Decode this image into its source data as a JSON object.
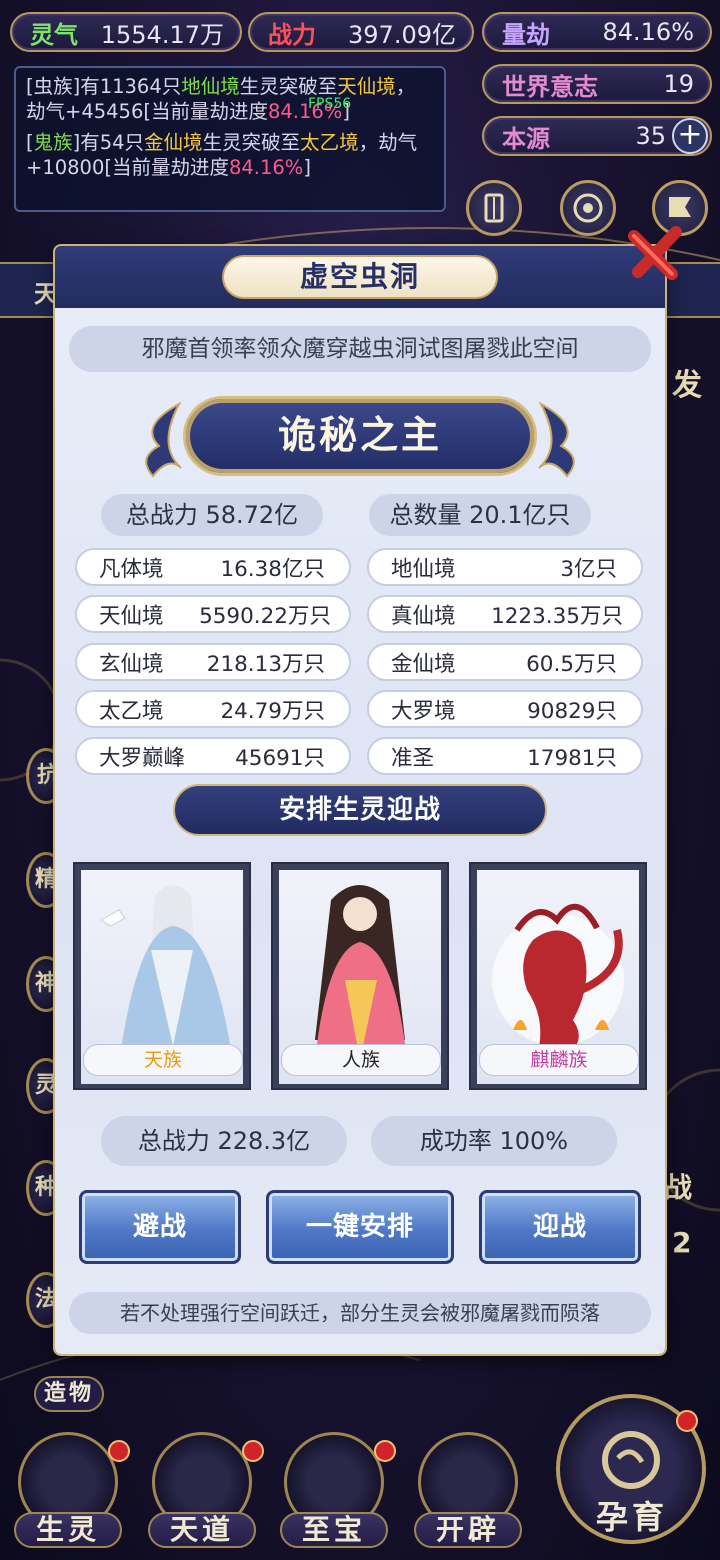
{
  "resources": {
    "lingqi": {
      "label": "灵气",
      "value": "1554.17万"
    },
    "zhanli": {
      "label": "战力",
      "value": "397.09亿"
    },
    "liangjie": {
      "label": "量劫",
      "value": "84.16%"
    },
    "shijie": {
      "label": "世界意志",
      "value": "19"
    },
    "benyuan": {
      "label": "本源",
      "value": "35"
    }
  },
  "fps": "FPS56",
  "log": [
    {
      "a": "[虫族]有11364只",
      "b": "地仙境",
      "c": "生灵突破至",
      "d": "天仙境",
      "e": "，劫气+45456[当前量劫进度",
      "f": "84.16%",
      "g": "]"
    },
    {
      "a": "[",
      "a2": "鬼族",
      "a3": "]有54只",
      "b": "金仙境",
      "c": "生灵突破至",
      "d": "太乙境",
      "e": "，劫气+10800[当前量劫进度",
      "f": "84.16%",
      "g": "]"
    }
  ],
  "side_left": {
    "t1": "天"
  },
  "side_right": {
    "t1": "发",
    "t2": "战",
    "t3": "2"
  },
  "left_buttons": [
    "抗",
    "精",
    "神",
    "灵",
    "种",
    "法"
  ],
  "zaowu": "造物",
  "modal": {
    "title": "虚空虫洞",
    "banner": "邪魔首领率领众魔穿越虫洞试图屠戮此空间",
    "boss": "诡秘之主",
    "total_power": "总战力 58.72亿",
    "total_count": "总数量 20.1亿只",
    "realms": [
      {
        "name": "凡体境",
        "count": "16.38亿只"
      },
      {
        "name": "地仙境",
        "count": "3亿只"
      },
      {
        "name": "天仙境",
        "count": "5590.22万只"
      },
      {
        "name": "真仙境",
        "count": "1223.35万只"
      },
      {
        "name": "玄仙境",
        "count": "218.13万只"
      },
      {
        "name": "金仙境",
        "count": "60.5万只"
      },
      {
        "name": "太乙境",
        "count": "24.79万只"
      },
      {
        "name": "大罗境",
        "count": "90829只"
      },
      {
        "name": "大罗巅峰",
        "count": "45691只"
      },
      {
        "name": "准圣",
        "count": "17981只"
      }
    ],
    "subhead": "安排生灵迎战",
    "cards": [
      {
        "label": "天族",
        "color": "#e89a12"
      },
      {
        "label": "人族",
        "color": "#222222"
      },
      {
        "label": "麒麟族",
        "color": "#c23ea6"
      }
    ],
    "our_power": "总战力 228.3亿",
    "success": "成功率 100%",
    "btn_avoid": "避战",
    "btn_auto": "一键安排",
    "btn_fight": "迎战",
    "note": "若不处理强行空间跃迁，部分生灵会被邪魔屠戮而陨落"
  },
  "nav": [
    "生灵",
    "天道",
    "至宝",
    "开辟",
    "孕育"
  ]
}
